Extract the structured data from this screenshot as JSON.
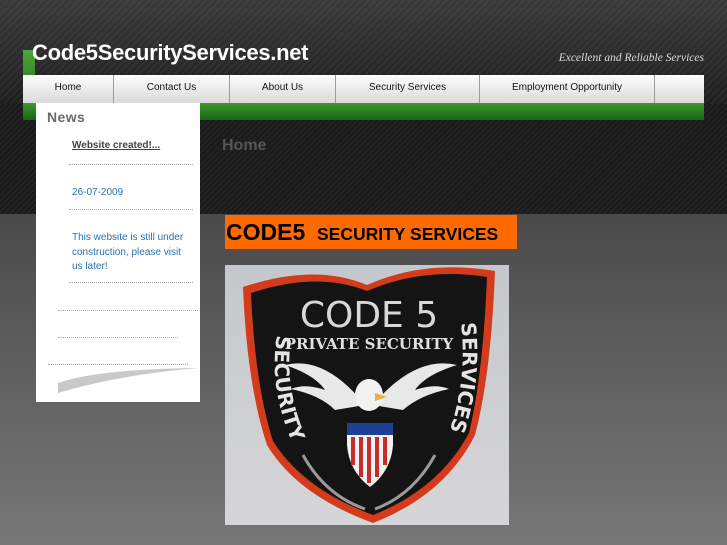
{
  "header": {
    "site_title": "Code5SecurityServices.net",
    "tagline": "Excellent and Reliable Services"
  },
  "nav": {
    "items": [
      {
        "label": "Home"
      },
      {
        "label": "Contact Us"
      },
      {
        "label": "About Us"
      },
      {
        "label": "Security Services"
      },
      {
        "label": "Employment Opportunity"
      }
    ]
  },
  "sidebar": {
    "title": "News",
    "item": {
      "link_text": "Website created!...",
      "date": "26-07-2009",
      "text": "This website is still under construction, please visit us later!"
    }
  },
  "main": {
    "page_heading": "Home",
    "banner": {
      "primary": "CODE5",
      "secondary": "SECURITY SERVICES"
    },
    "photo": {
      "badge_line1": "CODE 5",
      "badge_line2": "PRIVATE SECURITY",
      "badge_arc_left": "SECURITY",
      "badge_arc_right": "SERVICES"
    }
  },
  "colors": {
    "accent_green": "#2e8a24",
    "banner_orange": "#ff6a00",
    "link_blue": "#2b6fb0"
  }
}
